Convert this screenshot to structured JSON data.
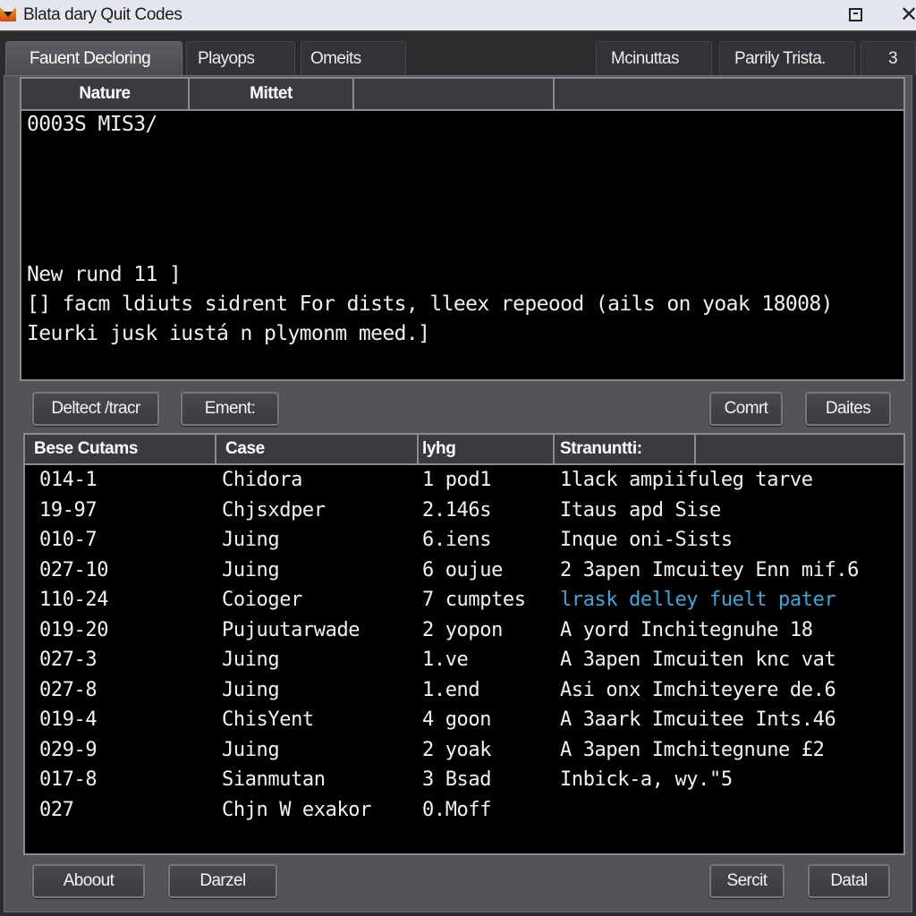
{
  "window": {
    "title": "Blata dary Quit Codes",
    "icon": "app-logo-icon",
    "controls": {
      "restore_icon": "restore-icon",
      "close_glyph": "✕"
    }
  },
  "tabs": [
    {
      "label": "Fauent Decloring",
      "active": true
    },
    {
      "label": "Playops",
      "active": false
    },
    {
      "label": "Omeits",
      "active": false
    },
    {
      "label": "Mcinuttas",
      "active": false
    },
    {
      "label": "Parrily Trista.",
      "active": false
    },
    {
      "label": "3",
      "active": false
    }
  ],
  "upper_grid": {
    "columns": [
      "Nature",
      "Mittet",
      "",
      ""
    ],
    "console_lines": [
      "0003S MIS3/",
      "New rund 11 ]",
      "[] facm ldiuts sidrent For dists, lleex repeood (ails on yoak 18008)",
      "Ieurki jusk iustá n plymonm meed.]"
    ]
  },
  "mid_buttons": {
    "detect": "Deltect /tracr",
    "element": "Ement:",
    "comm": "Comrt",
    "dates": "Daites"
  },
  "table": {
    "columns": [
      "Bese Cutams",
      "Case",
      "lyhg",
      "Stranuntti:",
      ""
    ],
    "rows": [
      {
        "code": "014-1",
        "case": "Chidora",
        "type": "1 pod1",
        "status": "1lack ampiifuleg tarve",
        "highlight": false
      },
      {
        "code": "19-97",
        "case": "Chjsxdper",
        "type": "2.146s",
        "status": "Itaus apd Sise",
        "highlight": false
      },
      {
        "code": "010-7",
        "case": "Juing",
        "type": "6.iens",
        "status": "Inque oni-Sists",
        "highlight": false
      },
      {
        "code": "027-10",
        "case": "Juing",
        "type": "6 oujue",
        "status": "2 3apen Imcuitey Enn mif.6",
        "highlight": false
      },
      {
        "code": "110-24",
        "case": "Coioger",
        "type": "7 cumptes",
        "status": "lrask delley fuelt pater",
        "highlight": true
      },
      {
        "code": "019-20",
        "case": "Pujuutarwade",
        "type": "2 yopon",
        "status": "A yord Inchitegnuhe 18",
        "highlight": false
      },
      {
        "code": "027-3",
        "case": "Juing",
        "type": "1.ve",
        "status": "A 3apen Imcuiten knc vat",
        "highlight": false
      },
      {
        "code": "027-8",
        "case": "Juing",
        "type": "1.end",
        "status": "Asi onx Imchiteyere de.6",
        "highlight": false
      },
      {
        "code": "019-4",
        "case": "ChisYent",
        "type": "4 goon",
        "status": "A 3aark Imcuitee Ints.46",
        "highlight": false
      },
      {
        "code": "029-9",
        "case": "Juing",
        "type": "2 yoak",
        "status": "A 3apen Imchitegnune £2",
        "highlight": false
      },
      {
        "code": "017-8",
        "case": "Sianmutan",
        "type": "3 Bsad",
        "status": "Inbick-a, wy.\"5",
        "highlight": false
      },
      {
        "code": "027",
        "case": "Chjn W exakor",
        "type": "0.Moff",
        "status": "",
        "highlight": false
      }
    ]
  },
  "bottom_buttons": {
    "about": "Aboout",
    "cancel": "Darzel",
    "search": "Sercit",
    "detail": "Datal"
  },
  "colors": {
    "highlight_text": "#35a9df",
    "console_bg": "#000000",
    "panel_bg": "#545357"
  }
}
